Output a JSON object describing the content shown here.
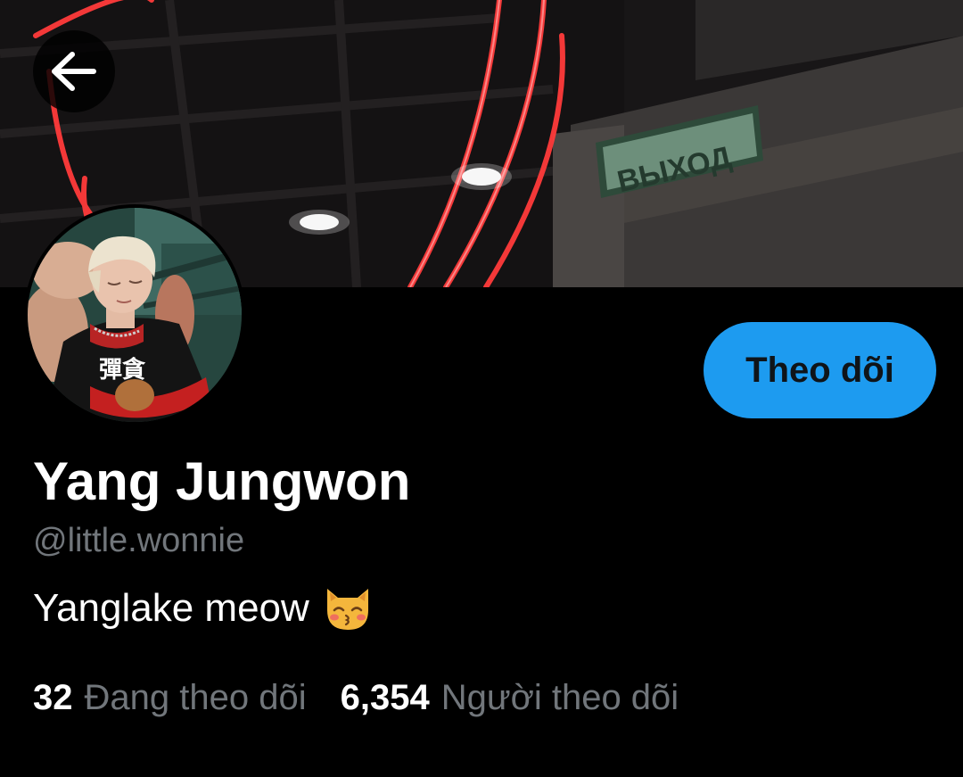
{
  "banner": {
    "exit_sign_text": "ВЫХОД"
  },
  "header": {
    "back_icon": "arrow-left-icon"
  },
  "profile": {
    "avatar_shirt_text": "彈貪",
    "display_name": "Yang Jungwon",
    "handle": "@little.wonnie",
    "bio_text": "Yanglake meow",
    "bio_emoji": "kissing-cat-emoji",
    "follow_label": "Theo dõi",
    "follow_color": "#1d9bf0"
  },
  "stats": {
    "following_count": "32",
    "following_label": "Đang theo dõi",
    "followers_count": "6,354",
    "followers_label": "Người theo dõi"
  },
  "colors": {
    "background": "#000000",
    "secondary_text": "#71767b",
    "accent": "#1d9bf0"
  }
}
